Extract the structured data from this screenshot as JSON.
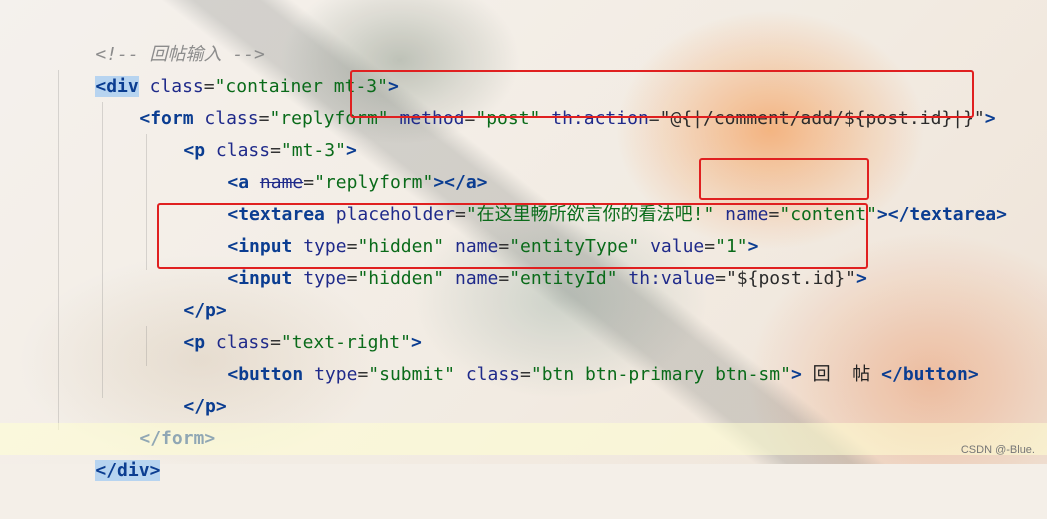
{
  "code_lines": [
    {
      "comment": "<!-- 回帖输入 -->"
    },
    {
      "open": "<",
      "tag": "div",
      "attr1": "class",
      "val1": "\"container mt-3\"",
      "close": ">"
    },
    {
      "open": "<",
      "tag": "form",
      "attr1": "class",
      "val1": "\"replyform\"",
      "attr2": "method",
      "val2": "\"post\"",
      "attr3": "th:action",
      "val3": "\"@{|/comment/add/${post.id}|}\"",
      "close": ">"
    },
    {
      "open": "<",
      "tag": "p",
      "attr1": "class",
      "val1": "\"mt-3\"",
      "close": ">"
    },
    {
      "open": "<",
      "tag": "a",
      "attr1": "name",
      "val1": "\"replyform\"",
      "close": "></a>"
    },
    {
      "open": "<",
      "tag": "textarea",
      "attr1": "placeholder",
      "val1": "\"在这里畅所欲言你的看法吧!\"",
      "attr2": "name",
      "val2": "\"content\"",
      "close": "></textarea>"
    },
    {
      "open": "<",
      "tag": "input",
      "attr1": "type",
      "val1": "\"hidden\"",
      "attr2": "name",
      "val2": "\"entityType\"",
      "attr3": "value",
      "val3": "\"1\"",
      "close": ">"
    },
    {
      "open": "<",
      "tag": "input",
      "attr1": "type",
      "val1": "\"hidden\"",
      "attr2": "name",
      "val2": "\"entityId\"",
      "attr3": "th:value",
      "val3": "\"${post.id}\"",
      "close": ">"
    },
    {
      "open": "</",
      "tag": "p",
      "close": ">"
    },
    {
      "open": "<",
      "tag": "p",
      "attr1": "class",
      "val1": "\"text-right\"",
      "close": ">"
    },
    {
      "open": "<",
      "tag": "button",
      "attr1": "type",
      "val1": "\"submit\"",
      "attr2": "class",
      "val2": "\"btn btn-primary btn-sm\"",
      "close": ">",
      "text": " 回  帖 ",
      "end": "</button>"
    },
    {
      "open": "</",
      "tag": "p",
      "close": ">"
    },
    {
      "open": "</",
      "tag": "form",
      "close": ">"
    },
    {
      "open": "</",
      "tag": "div",
      "close": ">"
    }
  ],
  "watermark": "CSDN @-Blue.",
  "colors": {
    "highlight_box": "#e02020",
    "tag": "#0b3d91",
    "string": "#0a6b1a",
    "comment": "#8c8c8c"
  }
}
